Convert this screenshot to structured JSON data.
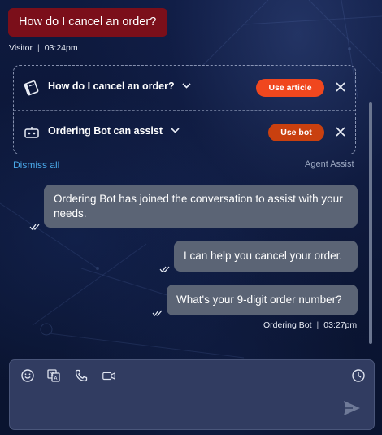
{
  "visitor": {
    "message": "How do I cancel an order?",
    "sender": "Visitor",
    "time": "03:24pm"
  },
  "agent_assist": {
    "suggestions": [
      {
        "title": "How do I cancel an order?",
        "action_label": "Use article",
        "icon": "book-icon",
        "action_color": "#f0471e"
      },
      {
        "title": "Ordering Bot can assist",
        "action_label": "Use bot",
        "icon": "bot-icon",
        "action_color": "#c9400f"
      }
    ],
    "dismiss_all_label": "Dismiss all",
    "label": "Agent Assist"
  },
  "conversation": {
    "bot_messages": [
      "Ordering Bot has joined the conversation to assist with your needs.",
      "I can help you cancel your order.",
      "What's your 9-digit order number?"
    ],
    "bot_sender": "Ordering Bot",
    "bot_time": "03:27pm"
  },
  "composer": {
    "tools": [
      "emoji-icon",
      "translate-icon",
      "phone-icon",
      "video-icon",
      "clock-icon"
    ],
    "placeholder": "",
    "send_icon": "send-icon"
  },
  "colors": {
    "visitor_bubble": "#7b0f1a",
    "bot_bubble": "#5b6475",
    "link": "#4aa8e8",
    "background": "#0c1736"
  }
}
